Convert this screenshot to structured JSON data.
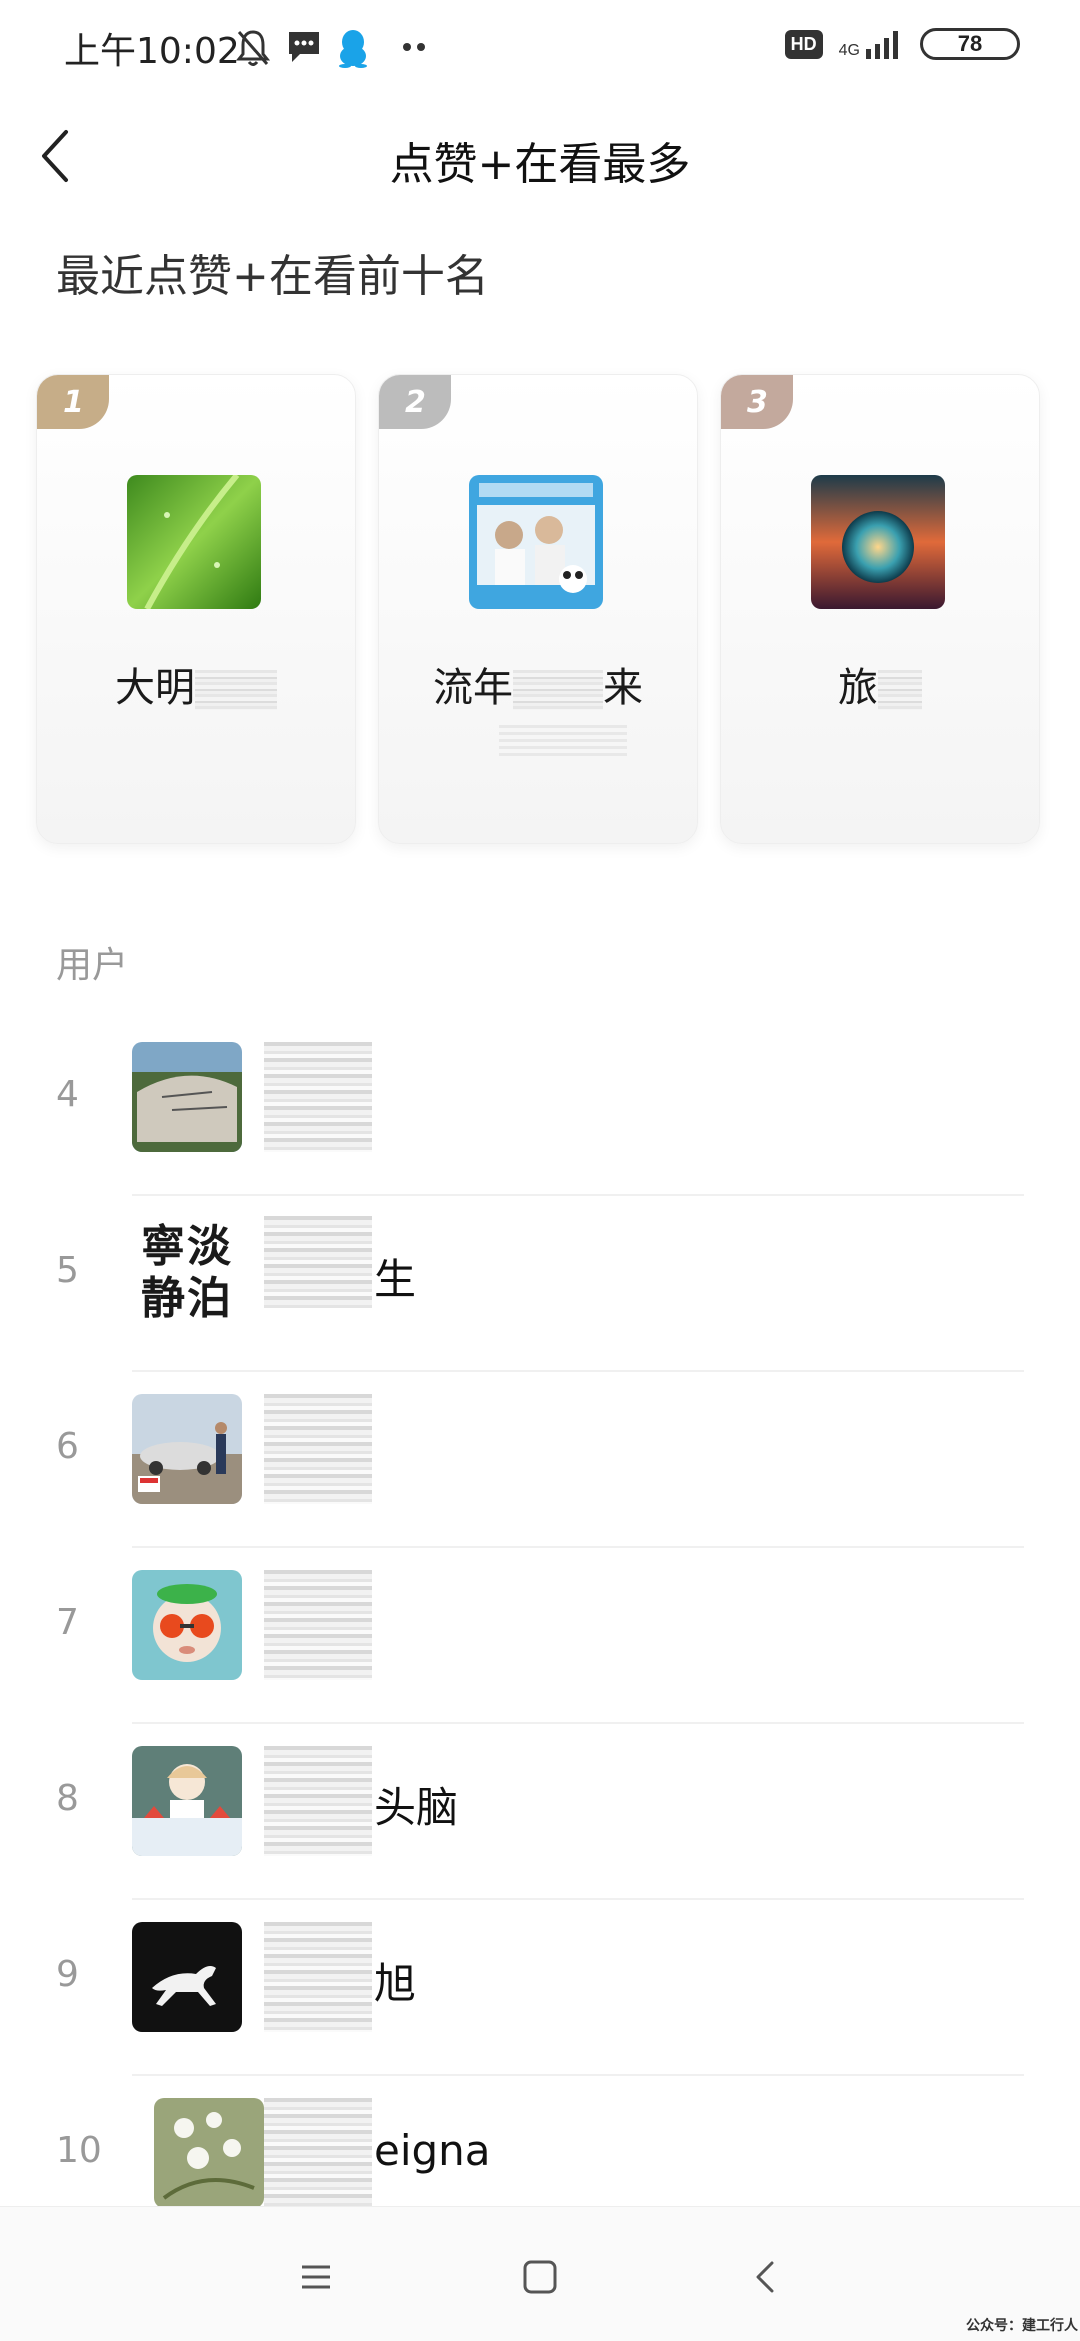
{
  "status_bar": {
    "time": "上午10:02",
    "hd": "HD",
    "network": "4G",
    "battery": "78",
    "icons": [
      "silent-bell-icon",
      "message-icon",
      "qq-penguin-icon",
      "more-dots-icon",
      "signal-icon"
    ]
  },
  "header": {
    "title": "点赞+在看最多",
    "back_icon": "chevron-left-icon"
  },
  "section_title": "最近点赞+在看前十名",
  "top3": [
    {
      "rank": "1",
      "name": "大明",
      "badge_color": "#c6ad88",
      "avatar": "green-leaf"
    },
    {
      "rank": "2",
      "name_prefix": "流年",
      "name_suffix": "来",
      "badge_color": "#bcbcbc",
      "avatar": "shared-future-poster"
    },
    {
      "rank": "3",
      "name": "旅",
      "badge_color": "#c3a99d",
      "avatar": "crystal-ball-sunset"
    }
  ],
  "list_header": "用户",
  "users": [
    {
      "rank": "4",
      "name": "",
      "avatar": "stone-monument"
    },
    {
      "rank": "5",
      "name": "生",
      "avatar": "text-calligraphy",
      "avatar_text_1": "寧淡",
      "avatar_text_2": "静泊"
    },
    {
      "rank": "6",
      "name": "",
      "avatar": "man-with-car"
    },
    {
      "rank": "7",
      "name": "",
      "avatar": "baby-sunglasses"
    },
    {
      "rank": "8",
      "name": "头脑",
      "avatar": "cartoon-girl-watermelon"
    },
    {
      "rank": "9",
      "name": "旭",
      "avatar": "white-horse"
    },
    {
      "rank": "10",
      "name": "eigna",
      "avatar": "white-flowers"
    }
  ],
  "colors": {
    "background": "#ffffff",
    "rank_gold": "#c6ad88",
    "rank_silver": "#bcbcbc",
    "rank_bronze": "#c3a99d",
    "muted_text": "#999999"
  },
  "nav": {
    "icons": [
      "menu-icon",
      "home-square-icon",
      "back-triangle-icon"
    ]
  },
  "watermark": "公众号：建工行人"
}
